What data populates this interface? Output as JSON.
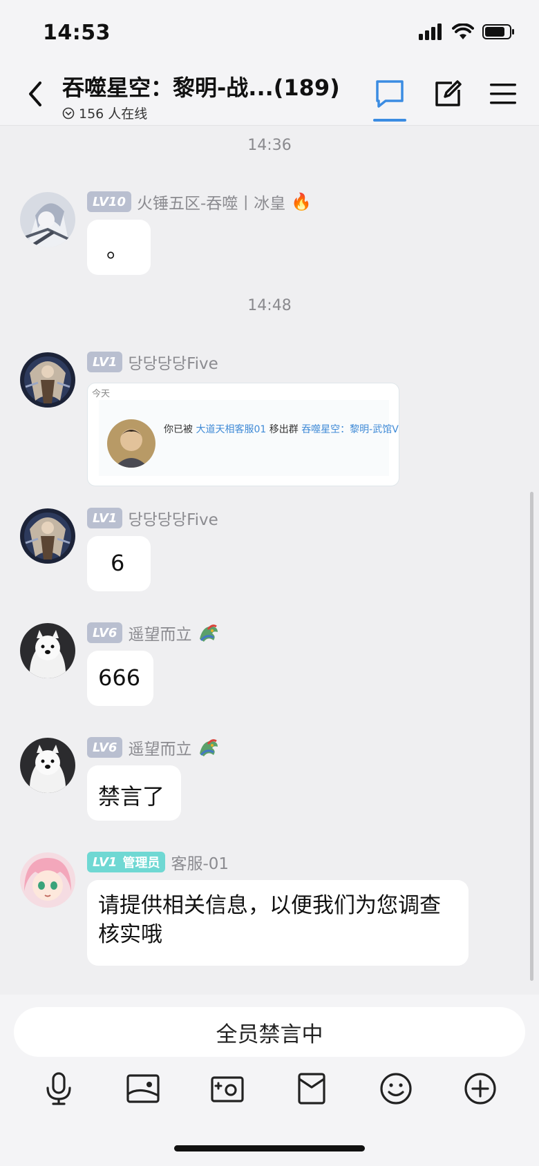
{
  "status_bar": {
    "time": "14:53"
  },
  "header": {
    "title": "吞噬星空：黎明-战...(189)",
    "online": "156 人在线"
  },
  "messages": [
    {
      "timestamp": "14:36"
    },
    {
      "level": "LV10",
      "username": "火锤五区-吞噬丨冰皇",
      "username_emoji": "🔥",
      "text": "。"
    },
    {
      "timestamp": "14:48"
    },
    {
      "level": "LV1",
      "username": "당당당당Five",
      "image": {
        "date_label": "今天",
        "prefix": "你已被",
        "actor": "大道天相客服01",
        "action": "移出群",
        "group": "吞噬星空：黎明-武馆VI"
      }
    },
    {
      "level": "LV1",
      "username": "당당당당Five",
      "text": "6"
    },
    {
      "level": "LV6",
      "username": "遥望而立",
      "text": "666"
    },
    {
      "level": "LV6",
      "username": "遥望而立",
      "text": "禁言了"
    },
    {
      "level": "LV1",
      "role": "管理员",
      "username": "客服-01",
      "text": "请提供相关信息，以便我们为您调查核实哦"
    }
  ],
  "input": {
    "muted_label": "全员禁言中"
  },
  "toolbar": [
    "microphone-icon",
    "image-icon",
    "camera-icon",
    "red-packet-icon",
    "emoji-icon",
    "plus-icon"
  ],
  "colors": {
    "accent": "#3b8ce2",
    "level_badge": "#b9bfd0",
    "admin_badge": "#6fd8d3",
    "link": "#3f8ad6"
  }
}
